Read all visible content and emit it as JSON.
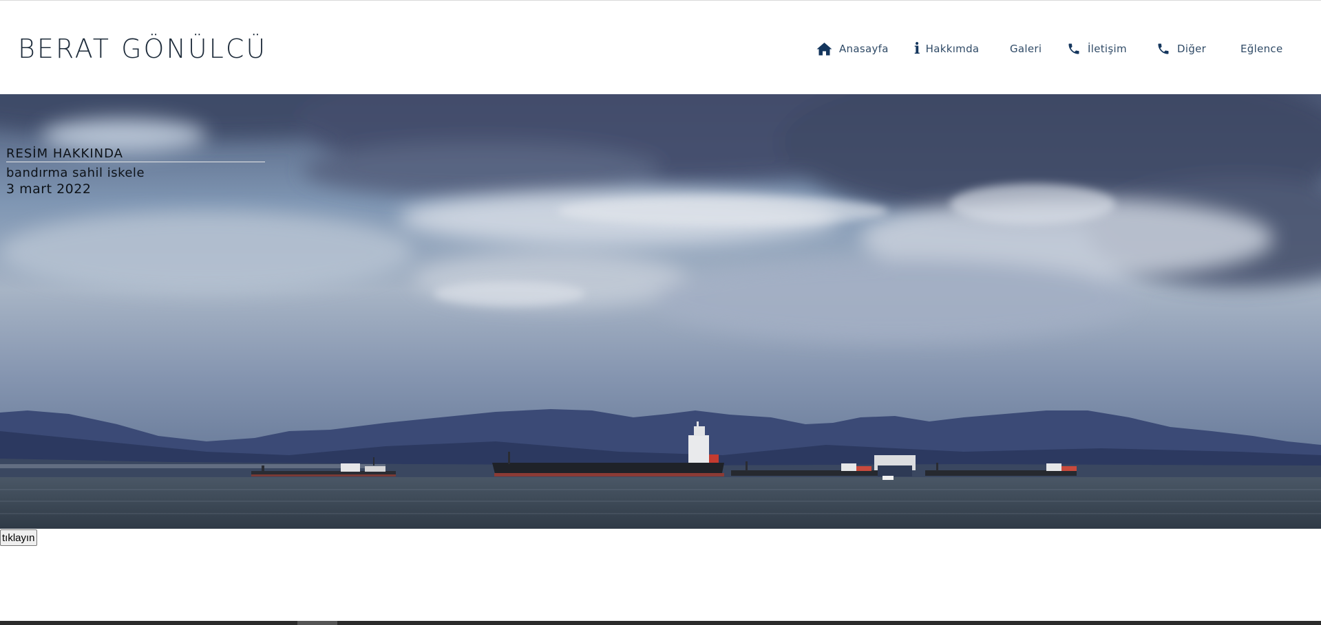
{
  "site": {
    "title": "BERAT GÖNÜLCÜ"
  },
  "nav": {
    "items": [
      {
        "label": "Anasayfa",
        "icon": "home-icon"
      },
      {
        "label": "Hakkımda",
        "icon": "info-icon"
      },
      {
        "label": "Galeri",
        "icon": ""
      },
      {
        "label": "İletişim",
        "icon": "phone-icon"
      },
      {
        "label": "Diğer",
        "icon": "phone-icon"
      },
      {
        "label": "Eğlence",
        "icon": ""
      }
    ]
  },
  "hero": {
    "caption_title": "RESİM HAKKINDA",
    "caption_location": "bandırma sahil iskele",
    "caption_date": "3 mart 2022"
  },
  "button": {
    "label": "tıklayın"
  },
  "colors": {
    "nav_text": "#2f4a66",
    "nav_icon": "#14365d",
    "logo": "#1d2b3a"
  }
}
